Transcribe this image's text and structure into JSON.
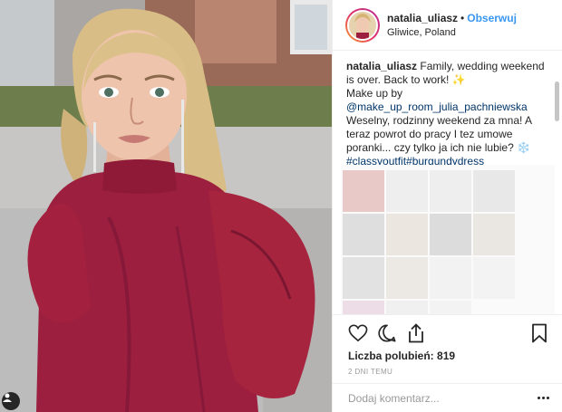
{
  "post": {
    "username": "natalia_uliasz",
    "separator": "•",
    "follow_label": "Obserwuj",
    "location": "Gliwice, Poland",
    "caption": {
      "text_1": "Family, wedding weekend is over. Back to work! ✨",
      "text_2": "Make up by",
      "mention": "@make_up_room_julia_pachniewska",
      "text_3": "Weselny, rodzinny weekend za mna! A teraz powrot do pracy I tez umowe poranki... czy tylko ja ich nie lubie? ❄️",
      "hashtags": "#classyoutfit#burgundydress"
    },
    "likes_label": "Liczba polubień:",
    "likes_count": "819",
    "time_ago": "2 DNI TEMU",
    "comment_placeholder": "Dodaj komentarz..."
  },
  "icons": {
    "like": "heart-icon",
    "comment": "comment-icon",
    "share": "share-icon",
    "save": "bookmark-icon",
    "more": "more-options-icon",
    "user_tag": "user-tag-icon"
  },
  "colors": {
    "dress": "#9c1f3f",
    "link": "#3897f0",
    "text": "#262626",
    "muted": "#999999"
  }
}
